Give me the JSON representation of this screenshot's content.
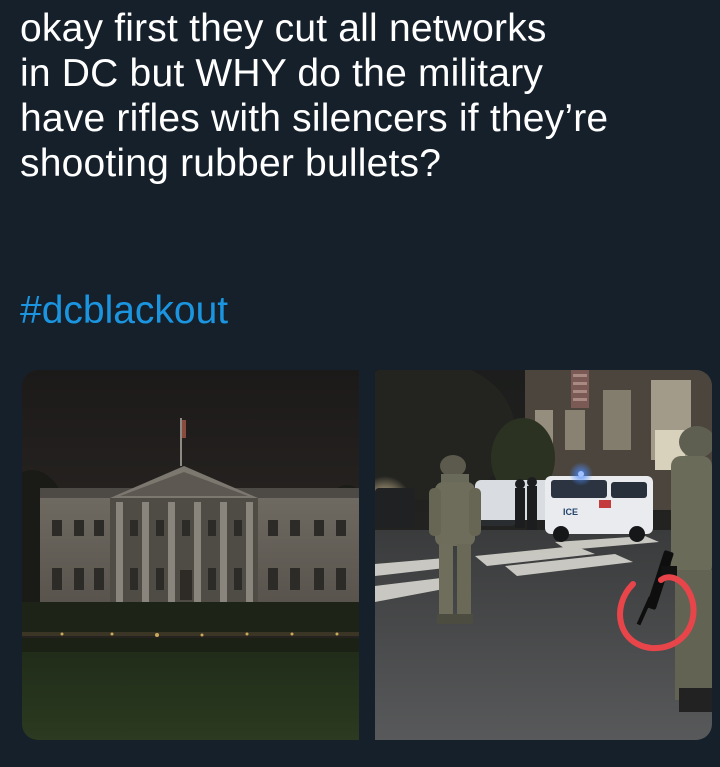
{
  "tweet": {
    "lines": [
      "okay first they cut all networks",
      "in DC but WHY do the military",
      "have rifles with silencers if they’re",
      "shooting rubber bullets?"
    ],
    "hashtag": "#dcblackout"
  },
  "media": {
    "left": {
      "description": "Dark White House at night"
    },
    "right": {
      "description": "Soldiers with rifles at night, police vehicles, rifle circled in red",
      "vehicle_text": "ICE"
    }
  },
  "colors": {
    "background": "#15202b",
    "text": "#ffffff",
    "hashtag": "#1b95e0",
    "annotation": "#e8454a"
  }
}
